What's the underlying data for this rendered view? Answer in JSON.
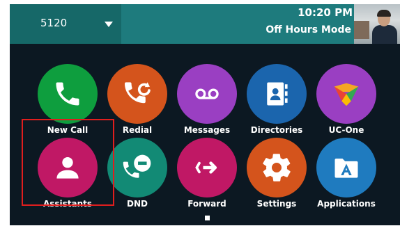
{
  "header": {
    "line": "5120",
    "time": "10:20 PM",
    "mode": "Off Hours Mode"
  },
  "apps": [
    {
      "label": "New Call",
      "icon": "phone-icon",
      "color": "#0e9e3e"
    },
    {
      "label": "Redial",
      "icon": "redial-icon",
      "color": "#d4541c"
    },
    {
      "label": "Messages",
      "icon": "voicemail-icon",
      "color": "#9a3fc2"
    },
    {
      "label": "Directories",
      "icon": "address-book-icon",
      "color": "#1b65ad"
    },
    {
      "label": "UC-One",
      "icon": "uc-one-logo-icon",
      "color": "#9a3fc2"
    },
    {
      "label": "Assistants",
      "icon": "person-icon",
      "color": "#c01865"
    },
    {
      "label": "DND",
      "icon": "dnd-icon",
      "color": "#128a75"
    },
    {
      "label": "Forward",
      "icon": "forward-icon",
      "color": "#c01865"
    },
    {
      "label": "Settings",
      "icon": "gear-icon",
      "color": "#d4541c"
    },
    {
      "label": "Applications",
      "icon": "applications-folder-icon",
      "color": "#1f7bbf"
    }
  ],
  "highlighted_app": "Assistants"
}
